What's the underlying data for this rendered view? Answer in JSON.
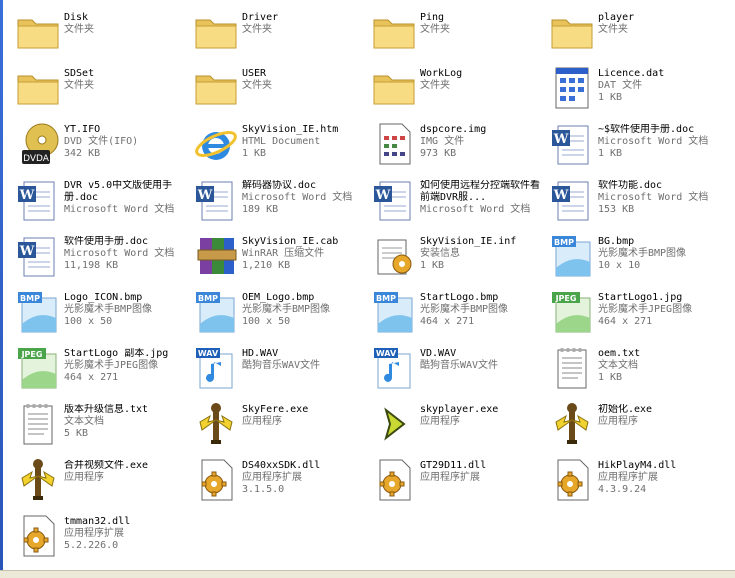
{
  "items": [
    {
      "name": "Disk",
      "detail1": "文件夹",
      "detail2": "",
      "icon": "folder-icon"
    },
    {
      "name": "Driver",
      "detail1": "文件夹",
      "detail2": "",
      "icon": "folder-icon"
    },
    {
      "name": "Ping",
      "detail1": "文件夹",
      "detail2": "",
      "icon": "folder-icon"
    },
    {
      "name": "player",
      "detail1": "文件夹",
      "detail2": "",
      "icon": "folder-icon"
    },
    {
      "name": "SDSet",
      "detail1": "文件夹",
      "detail2": "",
      "icon": "folder-icon"
    },
    {
      "name": "USER",
      "detail1": "文件夹",
      "detail2": "",
      "icon": "folder-icon"
    },
    {
      "name": "WorkLog",
      "detail1": "文件夹",
      "detail2": "",
      "icon": "folder-icon"
    },
    {
      "name": "Licence.dat",
      "detail1": "DAT 文件",
      "detail2": "1 KB",
      "icon": "dat-file-icon"
    },
    {
      "name": "YT.IFO",
      "detail1": "DVD 文件(IFO)",
      "detail2": "342 KB",
      "icon": "dvd-icon"
    },
    {
      "name": "SkyVision_IE.htm",
      "detail1": "HTML Document",
      "detail2": "1 KB",
      "icon": "ie-icon"
    },
    {
      "name": "dspcore.img",
      "detail1": "IMG 文件",
      "detail2": "973 KB",
      "icon": "img-file-icon"
    },
    {
      "name": "~$软件使用手册.doc",
      "detail1": "Microsoft Word 文档",
      "detail2": "1 KB",
      "icon": "word-doc-icon"
    },
    {
      "name": "DVR v5.0中文版使用手册.doc",
      "detail1": "Microsoft Word 文档",
      "detail2": "",
      "icon": "word-doc-icon"
    },
    {
      "name": "解码器协议.doc",
      "detail1": "Microsoft Word 文档",
      "detail2": "189 KB",
      "icon": "word-doc-icon"
    },
    {
      "name": "如何使用远程分控端软件看前端DVR服...",
      "detail1": "Microsoft Word 文档",
      "detail2": "",
      "icon": "word-doc-icon"
    },
    {
      "name": "软件功能.doc",
      "detail1": "Microsoft Word 文档",
      "detail2": "153 KB",
      "icon": "word-doc-icon"
    },
    {
      "name": "软件使用手册.doc",
      "detail1": "Microsoft Word 文档",
      "detail2": "11,198 KB",
      "icon": "word-doc-icon"
    },
    {
      "name": "SkyVision_IE.cab",
      "detail1": "WinRAR 压缩文件",
      "detail2": "1,210 KB",
      "icon": "winrar-icon"
    },
    {
      "name": "SkyVision_IE.inf",
      "detail1": "安装信息",
      "detail2": "1 KB",
      "icon": "setup-info-icon"
    },
    {
      "name": "BG.bmp",
      "detail1": "光影魔术手BMP图像",
      "detail2": "10 x 10",
      "icon": "bmp-icon"
    },
    {
      "name": "Logo_ICON.bmp",
      "detail1": "光影魔术手BMP图像",
      "detail2": "100 x 50",
      "icon": "bmp-icon"
    },
    {
      "name": "OEM_Logo.bmp",
      "detail1": "光影魔术手BMP图像",
      "detail2": "100 x 50",
      "icon": "bmp-icon"
    },
    {
      "name": "StartLogo.bmp",
      "detail1": "光影魔术手BMP图像",
      "detail2": "464 x 271",
      "icon": "bmp-icon"
    },
    {
      "name": "StartLogo1.jpg",
      "detail1": "光影魔术手JPEG图像",
      "detail2": "464 x 271",
      "icon": "jpeg-icon"
    },
    {
      "name": "StartLogo 副本.jpg",
      "detail1": "光影魔术手JPEG图像",
      "detail2": "464 x 271",
      "icon": "jpeg-icon"
    },
    {
      "name": "HD.WAV",
      "detail1": "酷狗音乐WAV文件",
      "detail2": "",
      "icon": "wav-icon"
    },
    {
      "name": "VD.WAV",
      "detail1": "酷狗音乐WAV文件",
      "detail2": "",
      "icon": "wav-icon"
    },
    {
      "name": "oem.txt",
      "detail1": "文本文档",
      "detail2": "1 KB",
      "icon": "text-file-icon"
    },
    {
      "name": "版本升级信息.txt",
      "detail1": "文本文档",
      "detail2": "5 KB",
      "icon": "text-file-icon"
    },
    {
      "name": "SkyFere.exe",
      "detail1": "应用程序",
      "detail2": "",
      "icon": "tower-app-icon"
    },
    {
      "name": "skyplayer.exe",
      "detail1": "应用程序",
      "detail2": "",
      "icon": "play-arrow-icon"
    },
    {
      "name": "初始化.exe",
      "detail1": "应用程序",
      "detail2": "",
      "icon": "tower-app-icon"
    },
    {
      "name": "合并视频文件.exe",
      "detail1": "应用程序",
      "detail2": "",
      "icon": "tower-app-icon"
    },
    {
      "name": "DS40xxSDK.dll",
      "detail1": "应用程序扩展",
      "detail2": "3.1.5.0",
      "icon": "dll-gear-icon"
    },
    {
      "name": "GT29D11.dll",
      "detail1": "应用程序扩展",
      "detail2": "",
      "icon": "dll-gear-icon"
    },
    {
      "name": "HikPlayM4.dll",
      "detail1": "应用程序扩展",
      "detail2": "4.3.9.24",
      "icon": "dll-gear-icon"
    },
    {
      "name": "tmman32.dll",
      "detail1": "应用程序扩展",
      "detail2": "5.2.226.0",
      "icon": "dll-gear-icon"
    }
  ]
}
